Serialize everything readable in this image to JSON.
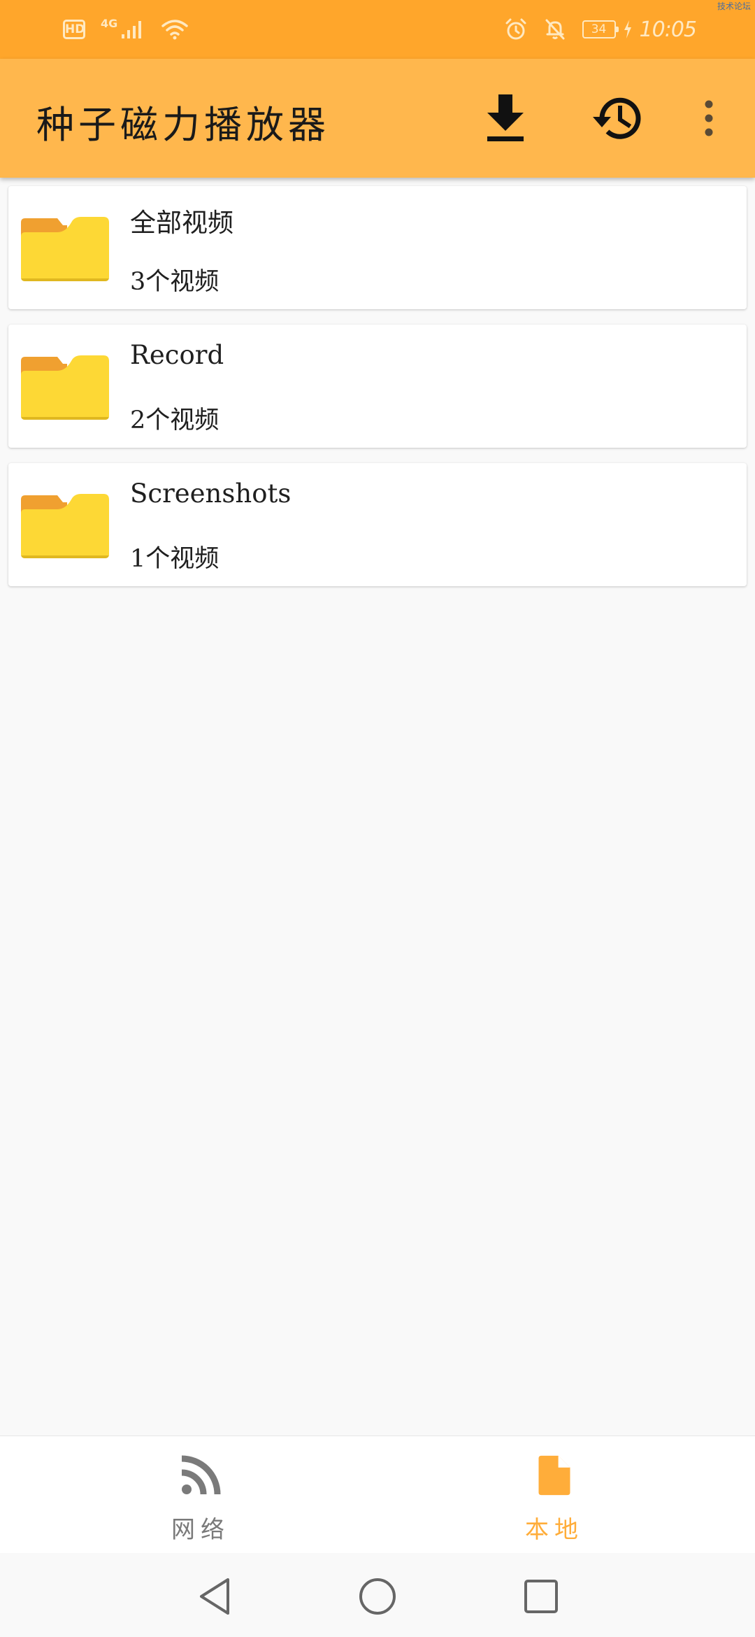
{
  "status_bar": {
    "hd": "HD",
    "network_type": "4G",
    "battery_level": "34",
    "time": "10:05",
    "watermark": "技术论坛",
    "icons": [
      "signal-icon",
      "wifi-icon",
      "alarm-icon",
      "mute-icon",
      "charging-icon"
    ]
  },
  "app_bar": {
    "title": "种子磁力播放器",
    "actions": [
      "download-icon",
      "history-icon",
      "more-vert-icon"
    ]
  },
  "folders": [
    {
      "name": "全部视频",
      "count": "3个视频"
    },
    {
      "name": "Record",
      "count": "2个视频"
    },
    {
      "name": "Screenshots",
      "count": "1个视频"
    }
  ],
  "bottom_nav": {
    "items": [
      {
        "label": "网络",
        "icon": "rss-feed-icon",
        "active": false
      },
      {
        "label": "本地",
        "icon": "file-icon",
        "active": true
      }
    ]
  },
  "colors": {
    "status_bar": "#ffa62b",
    "app_bar": "#ffb74d",
    "accent": "#ffad3a",
    "inactive": "#7a7a7a",
    "folder_front": "#fdd835",
    "folder_back": "#f0a030"
  }
}
